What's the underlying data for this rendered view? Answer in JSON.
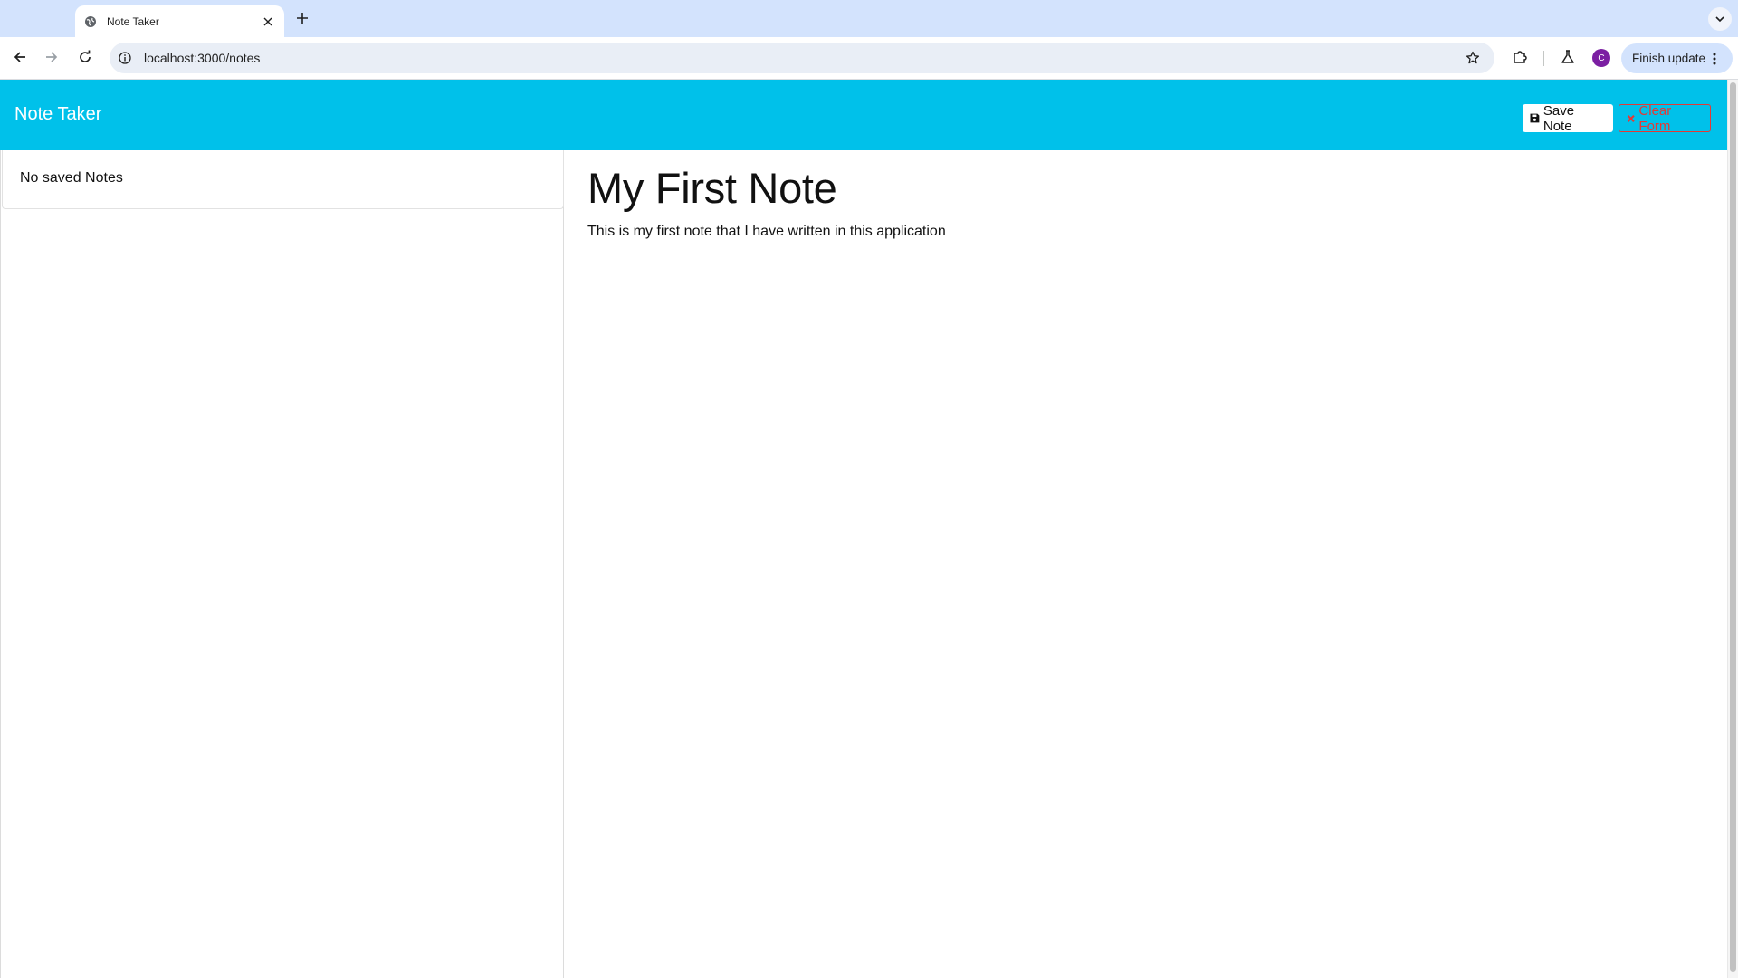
{
  "browser": {
    "tab_title": "Note Taker",
    "url": "localhost:3000/notes",
    "profile_initial": "C",
    "finish_update_label": "Finish update",
    "icons": {
      "favicon": "globe-icon",
      "tab_close": "close-icon",
      "new_tab": "plus-icon",
      "tab_search": "chevron-down-icon",
      "back": "arrow-left-icon",
      "forward": "arrow-right-icon",
      "reload": "reload-icon",
      "site_info": "info-icon",
      "bookmark": "star-icon",
      "extensions": "puzzle-icon",
      "labs": "flask-icon",
      "menu": "kebab-icon"
    }
  },
  "app": {
    "brand": "Note Taker",
    "save_label": "Save Note",
    "clear_label": "Clear Form",
    "colors": {
      "navbar": "#00c1ea",
      "clear": "#e53935"
    }
  },
  "sidebar": {
    "empty_message": "No saved Notes"
  },
  "note": {
    "title": "My First Note",
    "text": "This is my first note that I have written in this application"
  }
}
